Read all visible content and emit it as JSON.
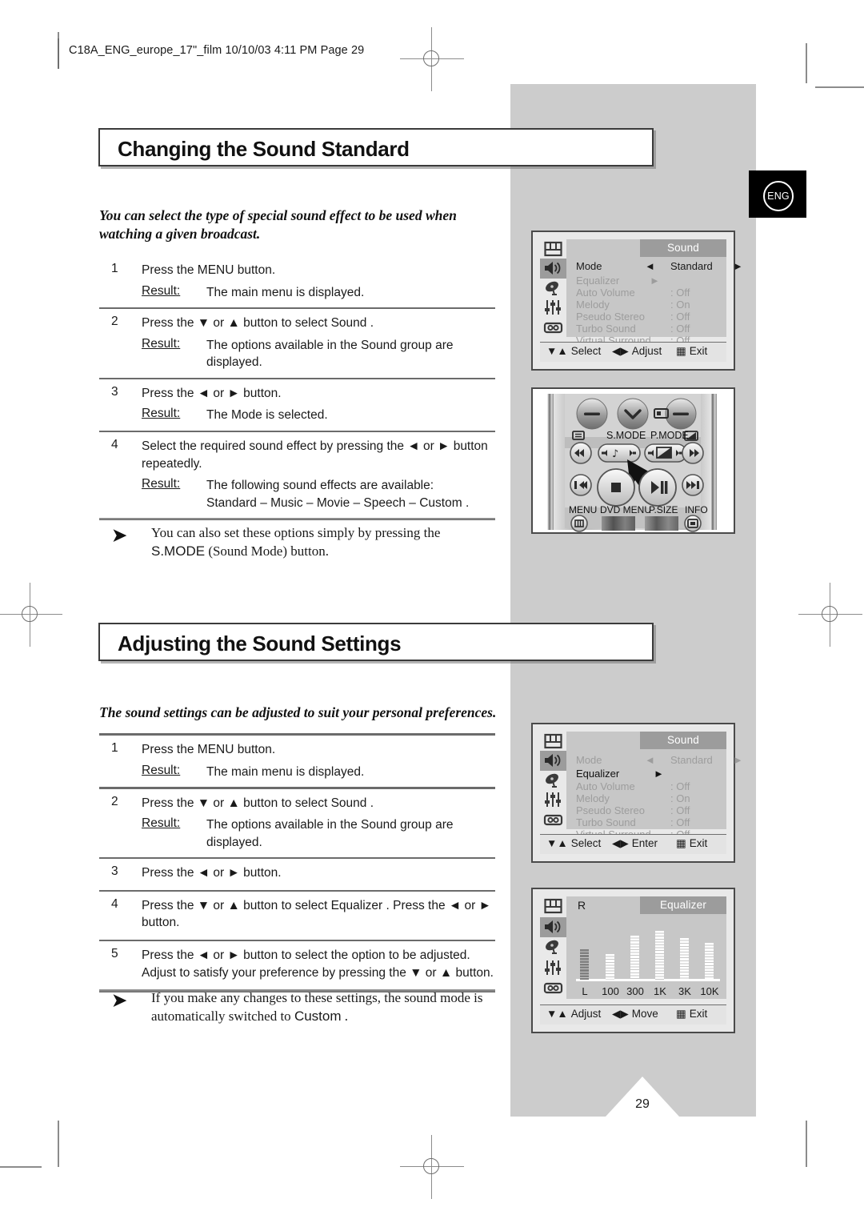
{
  "header": {
    "file_info": "C18A_ENG_europe_17\"_film  10/10/03  4:11 PM  Page 29"
  },
  "language_badge": {
    "label": "ENG"
  },
  "page_number": "29",
  "sections": [
    {
      "title": "Changing the Sound Standard",
      "intro": "You can select the type of special sound effect to be used when watching a given broadcast.",
      "steps": [
        {
          "number": "1",
          "instruction": "Press the MENU button.",
          "result_label": "Result:",
          "result": "The main menu is displayed."
        },
        {
          "number": "2",
          "instruction": "Press the ▼ or ▲ button to select Sound .",
          "result_label": "Result:",
          "result": "The options available in the Sound group are displayed."
        },
        {
          "number": "3",
          "instruction": "Press the ◄ or ► button.",
          "result_label": "Result:",
          "result": "The Mode is selected."
        },
        {
          "number": "4",
          "instruction": "Select the required sound effect by pressing the ◄ or ► button repeatedly.",
          "result_label": "Result:",
          "result": "The following sound effects are available:",
          "result_line2": "Standard  – Music  – Movie  – Speech  – Custom ."
        }
      ],
      "note": {
        "arrow": "➤",
        "text_part1": "You can also set these options simply by pressing the ",
        "text_bold": "S.MODE",
        "text_part2": " (Sound Mode) button."
      }
    },
    {
      "title": "Adjusting the Sound Settings",
      "intro": "The sound settings can be adjusted to suit your personal preferences.",
      "steps": [
        {
          "number": "1",
          "instruction": "Press the MENU button.",
          "result_label": "Result:",
          "result": "The main menu is displayed."
        },
        {
          "number": "2",
          "instruction": "Press the ▼ or ▲ button to select Sound .",
          "result_label": "Result:",
          "result": "The options available in the Sound group are displayed."
        },
        {
          "number": "3",
          "instruction": "Press the ◄ or ► button.",
          "result_label": "",
          "result": ""
        },
        {
          "number": "4",
          "instruction": "Press the ▼ or ▲ button to select Equalizer  . Press the ◄ or ► button.",
          "result_label": "",
          "result": ""
        },
        {
          "number": "5",
          "instruction": "Press the ◄ or ► button to select the option to be adjusted. Adjust to satisfy your preference by pressing the ▼ or ▲ button.",
          "result_label": "",
          "result": ""
        }
      ],
      "note": {
        "arrow": "➤",
        "text_part1": "If you make any changes to these settings, the sound mode is automatically switched to ",
        "text_bold": "Custom",
        "text_part2": " ."
      }
    }
  ],
  "osd_screens": [
    {
      "id": "sound-mode-menu",
      "title": "Sound",
      "icons": [
        "picture-icon",
        "sound-icon",
        "channel-icon",
        "feature-icon",
        "setup-icon"
      ],
      "selected_icon_index": 1,
      "rows": [
        {
          "name": "Mode",
          "value": "Standard",
          "state": "active",
          "left_arrow": "◄",
          "right_arrow": "►"
        },
        {
          "name": "Equalizer",
          "value": "",
          "state": "dim",
          "tri": "►"
        },
        {
          "name": "Auto Volume",
          "value": ": Off",
          "state": "dim"
        },
        {
          "name": "Melody",
          "value": ": On",
          "state": "dim"
        },
        {
          "name": "Pseudo Stereo",
          "value": ": Off",
          "state": "dim"
        },
        {
          "name": "Turbo Sound",
          "value": ": Off",
          "state": "dim"
        },
        {
          "name": "Virtual Surround",
          "value": ": Off",
          "state": "dim"
        }
      ],
      "footer": {
        "select": "Select",
        "middle": "Adjust",
        "exit": "Exit"
      }
    },
    {
      "id": "sound-equalizer-menu",
      "title": "Sound",
      "icons": [
        "picture-icon",
        "sound-icon",
        "channel-icon",
        "feature-icon",
        "setup-icon"
      ],
      "selected_icon_index": 1,
      "rows": [
        {
          "name": "Mode",
          "value": "Standard",
          "state": "dim",
          "left_arrow": "◄",
          "right_arrow": "►"
        },
        {
          "name": "Equalizer",
          "value": "",
          "state": "active",
          "tri": "►"
        },
        {
          "name": "Auto Volume",
          "value": ": Off",
          "state": "dim"
        },
        {
          "name": "Melody",
          "value": ": On",
          "state": "dim"
        },
        {
          "name": "Pseudo Stereo",
          "value": ": Off",
          "state": "dim"
        },
        {
          "name": "Turbo Sound",
          "value": ": Off",
          "state": "dim"
        },
        {
          "name": "Virtual Surround",
          "value": ": Off",
          "state": "dim"
        }
      ],
      "footer": {
        "select": "Select",
        "middle": "Enter",
        "exit": "Exit"
      }
    }
  ],
  "equalizer_screen": {
    "id": "equalizer-screen",
    "title": "Equalizer",
    "top_label": "R",
    "bottom_label": "L",
    "icons": [
      "picture-icon",
      "sound-icon",
      "channel-icon",
      "feature-icon",
      "setup-icon"
    ],
    "selected_icon_index": 1,
    "footer": {
      "select": "Adjust",
      "middle": "Move",
      "exit": "Exit"
    },
    "chart_data": {
      "type": "bar",
      "title": "Equalizer",
      "categories": [
        "L/R",
        "100",
        "300",
        "1K",
        "3K",
        "10K"
      ],
      "values": [
        50,
        42,
        72,
        80,
        68,
        60
      ],
      "ylim": [
        0,
        100
      ],
      "xlabel": "",
      "ylabel": "",
      "grid": false
    }
  },
  "remote": {
    "id": "remote-diagram",
    "labels_row1": [
      "S.MODE",
      "P.MODE"
    ],
    "labels_row2": [
      "MENU",
      "DVD MENU",
      "P.SIZE",
      "INFO"
    ],
    "highlight": "S.MODE"
  }
}
